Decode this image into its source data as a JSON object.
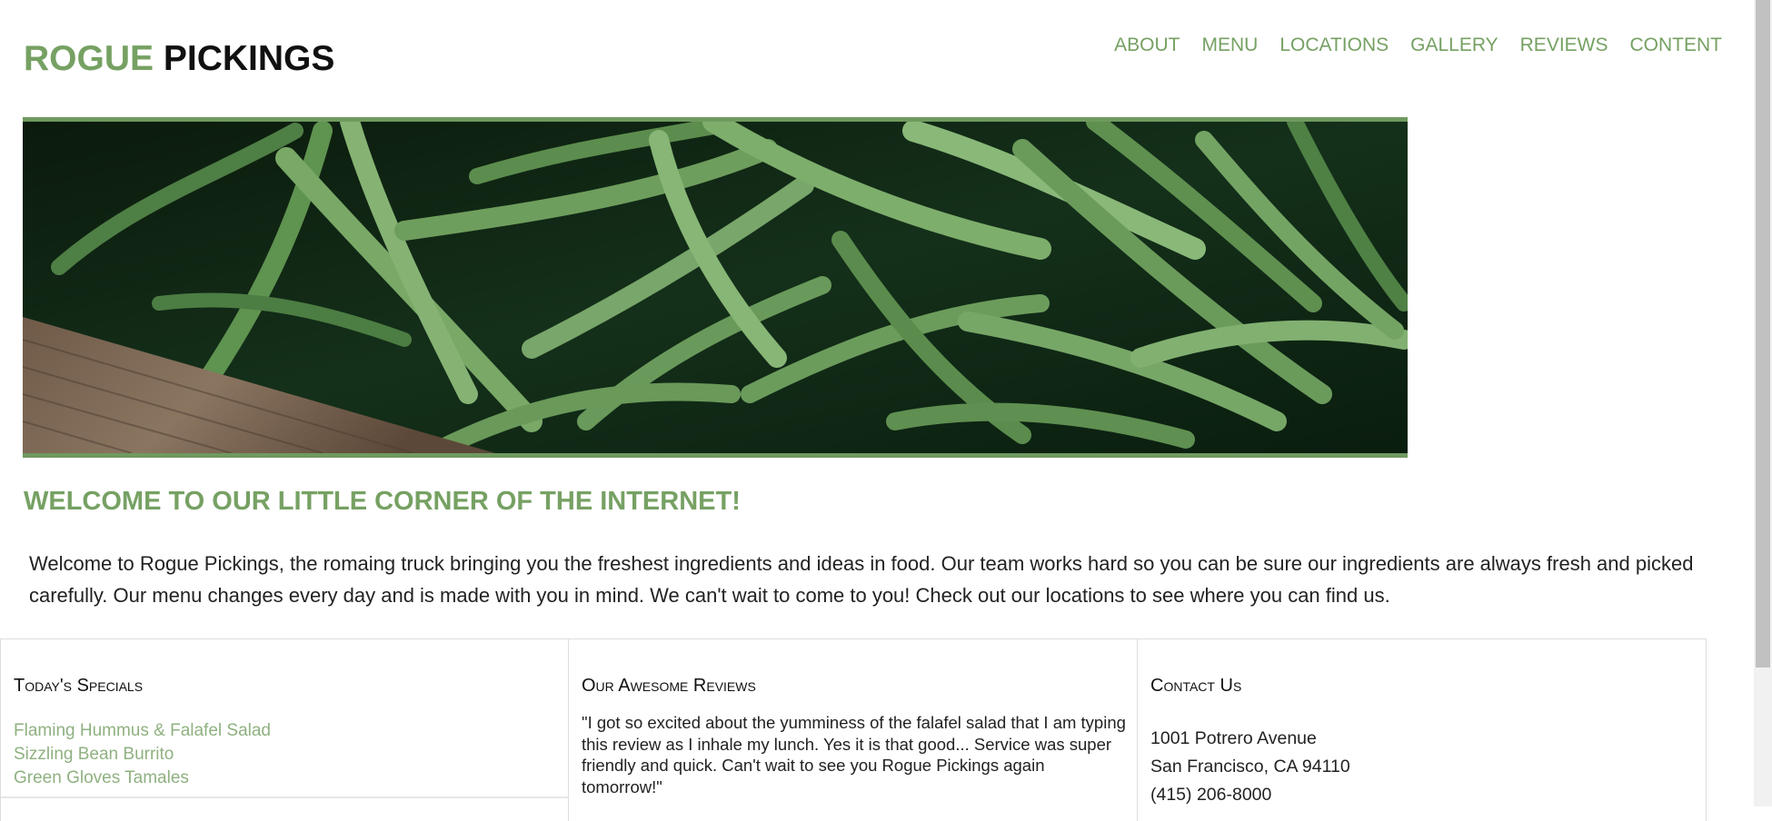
{
  "brand": {
    "part1": "ROGUE",
    "part2": "PICKINGS"
  },
  "nav": {
    "items": [
      {
        "label": "ABOUT"
      },
      {
        "label": "MENU"
      },
      {
        "label": "LOCATIONS"
      },
      {
        "label": "GALLERY"
      },
      {
        "label": "REVIEWS"
      },
      {
        "label": "CONTENT"
      }
    ]
  },
  "hero": {
    "image": "green-beans-photo"
  },
  "welcome": {
    "title": "WELCOME TO OUR LITTLE CORNER OF THE INTERNET!",
    "text": "Welcome to Rogue Pickings, the romaing truck bringing you the freshest ingredients and ideas in food. Our team works hard so you can be sure our ingredients are always fresh and picked carefully. Our menu changes every day and is made with you in mind. We can't wait to come to you! Check out our locations to see where you can find us."
  },
  "specials": {
    "title": "Today's Specials",
    "items": [
      "Flaming Hummus & Falafel Salad",
      "Sizzling Bean Burrito",
      "Green Gloves Tamales"
    ]
  },
  "reviews": {
    "title": "Our Awesome Reviews",
    "text": "\"I got so excited about the yumminess of the falafel salad that I am typing this review as I inhale my lunch. Yes it is that good... Service was super friendly and quick. Can't wait to see you Rogue Pickings again tomorrow!\""
  },
  "contact": {
    "title": "Contact Us",
    "address1": "1001 Potrero Avenue",
    "address2": "San Francisco, CA 94110",
    "phone": "(415) 206-8000"
  },
  "colors": {
    "accent": "#76a163",
    "accent_light": "#8fb180",
    "text": "#222222"
  }
}
